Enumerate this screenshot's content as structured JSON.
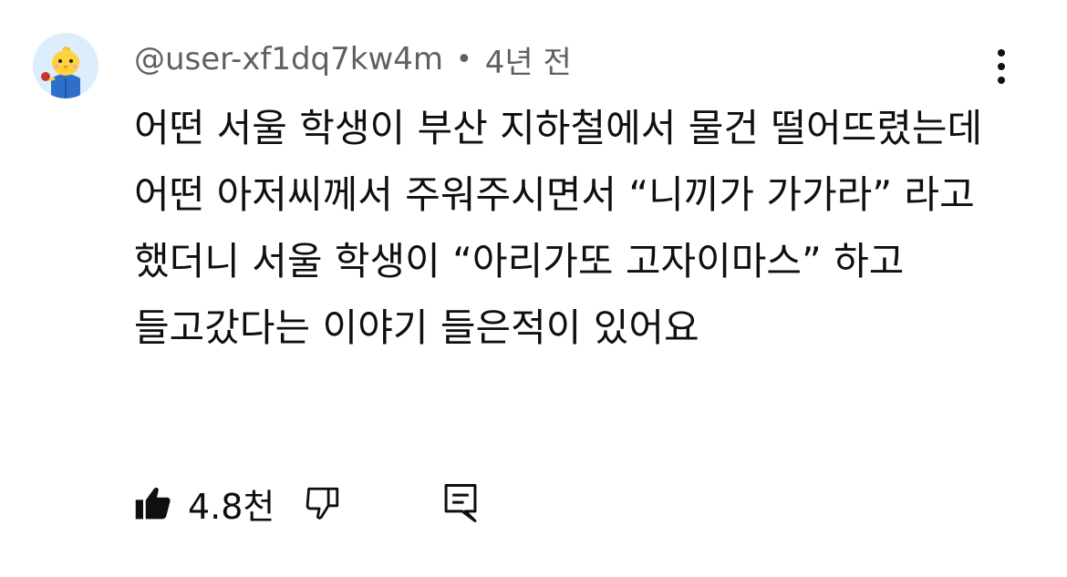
{
  "comment": {
    "author": "@user-xf1dq7kw4m",
    "separator": "•",
    "timestamp": "4년 전",
    "text": "어떤 서울 학생이 부산 지하철에서 물건 떨어뜨렸는데 어떤 아저씨께서 주워주시면서 “니끼가 가가라” 라고 했더니 서울 학생이 “아리가또 고자이마스” 하고 들고갔다는 이야기 들은적이 있어요",
    "like_count": "4.8천"
  },
  "icons": {
    "avatar": "yellow-chick-avatar",
    "more": "vertical-ellipsis-icon",
    "like": "thumbs-up-filled-icon",
    "dislike": "thumbs-down-outline-icon",
    "reply": "comment-reply-icon"
  },
  "colors": {
    "text": "#0f0f0f",
    "meta": "#606060",
    "background": "#ffffff",
    "avatar_bg": "#dceefc"
  }
}
